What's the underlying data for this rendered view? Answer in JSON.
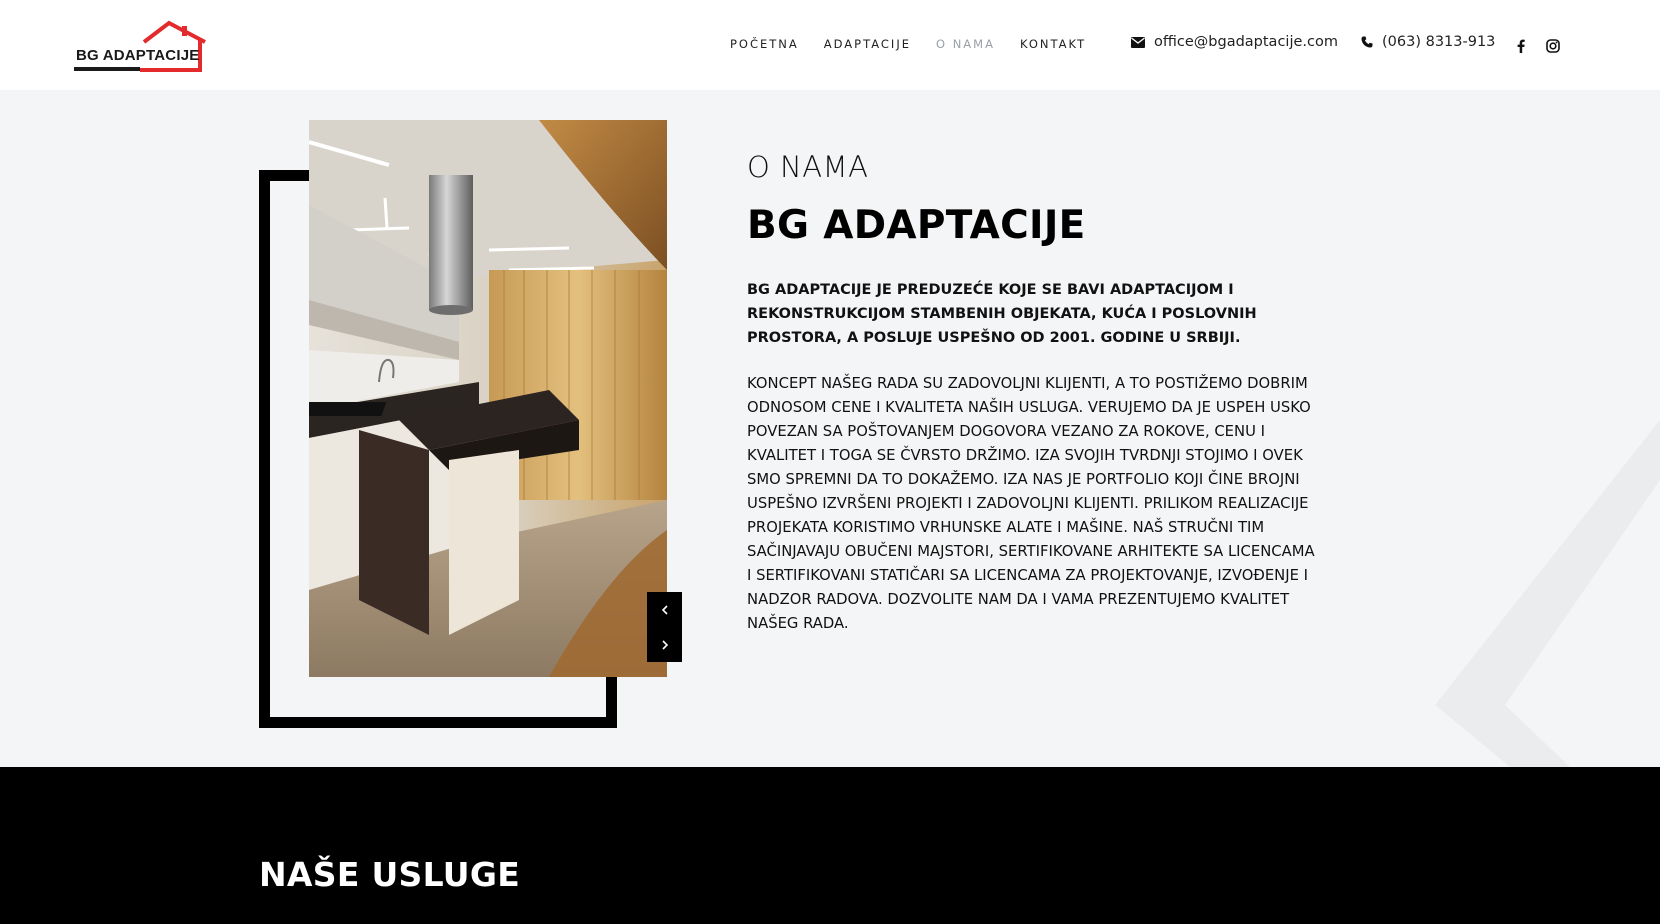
{
  "logo": {
    "text": "BG ADAPTACIJE",
    "accent_color": "#e32a2c"
  },
  "nav": {
    "items": [
      {
        "label": "POČETNA",
        "active": false
      },
      {
        "label": "ADAPTACIJE",
        "active": false
      },
      {
        "label": "O NAMA",
        "active": true
      },
      {
        "label": "KONTAKT",
        "active": false
      }
    ]
  },
  "contact": {
    "email": "office@bgadaptacije.com",
    "phone": "(063) 8313-913",
    "email_icon": "envelope-icon",
    "phone_icon": "phone-icon"
  },
  "social": {
    "icons": [
      "facebook-icon",
      "instagram-icon"
    ]
  },
  "about": {
    "subtitle": "O NAMA",
    "title": "BG ADAPTACIJE",
    "lead": "BG ADAPTACIJE JE PREDUZEĆE KOJE SE BAVI ADAPTACIJOM I REKONSTRUKCIJOM STAMBENIH OBJEKATA, KUĆA I POSLOVNIH PROSTORA, A POSLUJE USPEŠNO OD 2001. GODINE U SRBIJI.",
    "body": "KONCEPT NAŠEG RADA SU ZADOVOLJNI KLIJENTI, A TO POSTIŽEMO DOBRIM ODNOSOM CENE I KVALITETA NAŠIH USLUGA. VERUJEMO DA JE USPEH USKO POVEZAN SA POŠTOVANJEM DOGOVORA VEZANO ZA ROKOVE, CENU I KVALITET I TOGA SE ČVRSTO DRŽIMO. IZA SVOJIH TVRDNJI STOJIMO I OVEK SMO SPREMNI DA TO DOKAŽEMO. IZA NAS JE PORTFOLIO KOJI ČINE BROJNI USPEŠNO IZVRŠENI PROJEKTI I ZADOVOLJNI KLIJENTI. PRILIKOM REALIZACIJE PROJEKATA KORISTIMO VRHUNSKE ALATE I MAŠINE. NAŠ STRUČNI TIM SAČINJAVAJU OBUČENI MAJSTORI, SERTIFIKOVANE ARHITEKTE SA LICENCAMA I SERTIFIKOVANI STATIČARI SA LICENCAMA ZA PROJEKTOVANJE, IZVOĐENJE I NADZOR RADOVA. DOZVOLITE NAM DA I VAMA PREZENTUJEMO KVALITET NAŠEG RADA.",
    "slider": {
      "prev_icon": "chevron-left-icon",
      "next_icon": "chevron-right-icon"
    }
  },
  "services": {
    "title": "NAŠE USLUGE"
  }
}
